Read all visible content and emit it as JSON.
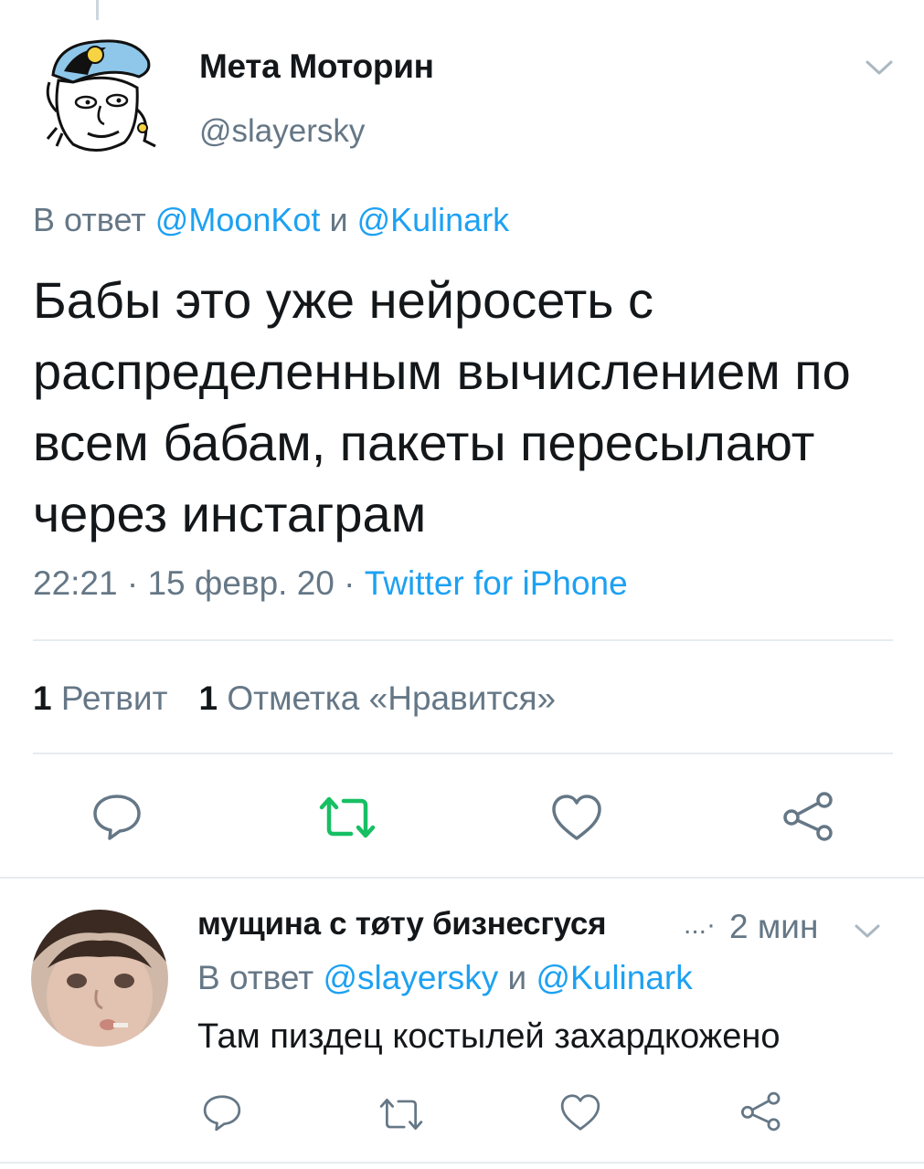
{
  "main_tweet": {
    "display_name": "Мета Моторин",
    "handle": "@slayersky",
    "reply_prefix": "В ответ",
    "reply_to_1": "@MoonKot",
    "reply_joiner": "и",
    "reply_to_2": "@Kulinark",
    "text": "Бабы это уже нейросеть с распределенным вычислением по всем бабам, пакеты пересылают через инстаграм",
    "time": "22:21",
    "date": "15 февр. 20",
    "source": "Twitter for iPhone",
    "retweet_count": "1",
    "retweet_label": "Ретвит",
    "like_count": "1",
    "like_label": "Отметка «Нравится»",
    "retweet_active_color": "#17bf63"
  },
  "reply_tweet": {
    "display_name": "мущина с тøту бизнесгуся",
    "ellipsis": "...·",
    "time": "2 мин",
    "reply_prefix": "В ответ",
    "reply_to_1": "@slayersky",
    "reply_joiner": "и",
    "reply_to_2": "@Kulinark",
    "text": "Там пиздец костылей захардкожено"
  },
  "icons": [
    "reply-icon",
    "retweet-icon",
    "like-icon",
    "share-icon",
    "chevron-down-icon"
  ],
  "colors": {
    "link": "#1da1f2",
    "secondary": "#657786",
    "text": "#14171a",
    "divider": "#e6ecf0"
  }
}
